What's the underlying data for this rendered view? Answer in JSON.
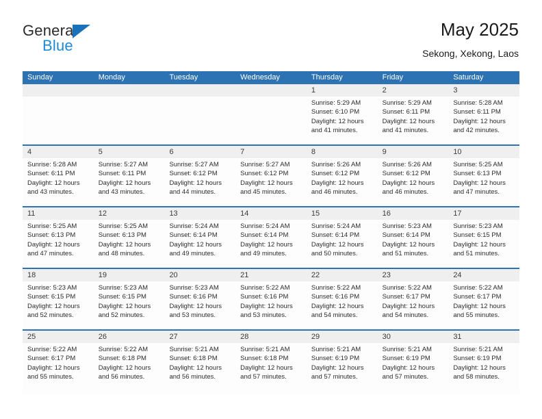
{
  "logo": {
    "primary_text": "General",
    "secondary_text": "Blue",
    "primary_color": "#2b2b2b",
    "secondary_color": "#1c8ad6",
    "triangle_color": "#1c72b8"
  },
  "header": {
    "title": "May 2025",
    "subtitle": "Sekong, Xekong, Laos"
  },
  "theme": {
    "header_blue": "#2d73b3",
    "row_divider_blue": "#2d73b3",
    "day_band_gray": "#efefef",
    "cell_background": "#fdfdfd",
    "text_color": "#2b2b2b"
  },
  "weekdays": [
    "Sunday",
    "Monday",
    "Tuesday",
    "Wednesday",
    "Thursday",
    "Friday",
    "Saturday"
  ],
  "weeks": [
    [
      {
        "day": "",
        "sunrise": "",
        "sunset": "",
        "daylight_line1": "",
        "daylight_line2": ""
      },
      {
        "day": "",
        "sunrise": "",
        "sunset": "",
        "daylight_line1": "",
        "daylight_line2": ""
      },
      {
        "day": "",
        "sunrise": "",
        "sunset": "",
        "daylight_line1": "",
        "daylight_line2": ""
      },
      {
        "day": "",
        "sunrise": "",
        "sunset": "",
        "daylight_line1": "",
        "daylight_line2": ""
      },
      {
        "day": "1",
        "sunrise": "Sunrise: 5:29 AM",
        "sunset": "Sunset: 6:10 PM",
        "daylight_line1": "Daylight: 12 hours",
        "daylight_line2": "and 41 minutes."
      },
      {
        "day": "2",
        "sunrise": "Sunrise: 5:29 AM",
        "sunset": "Sunset: 6:11 PM",
        "daylight_line1": "Daylight: 12 hours",
        "daylight_line2": "and 41 minutes."
      },
      {
        "day": "3",
        "sunrise": "Sunrise: 5:28 AM",
        "sunset": "Sunset: 6:11 PM",
        "daylight_line1": "Daylight: 12 hours",
        "daylight_line2": "and 42 minutes."
      }
    ],
    [
      {
        "day": "4",
        "sunrise": "Sunrise: 5:28 AM",
        "sunset": "Sunset: 6:11 PM",
        "daylight_line1": "Daylight: 12 hours",
        "daylight_line2": "and 43 minutes."
      },
      {
        "day": "5",
        "sunrise": "Sunrise: 5:27 AM",
        "sunset": "Sunset: 6:11 PM",
        "daylight_line1": "Daylight: 12 hours",
        "daylight_line2": "and 43 minutes."
      },
      {
        "day": "6",
        "sunrise": "Sunrise: 5:27 AM",
        "sunset": "Sunset: 6:12 PM",
        "daylight_line1": "Daylight: 12 hours",
        "daylight_line2": "and 44 minutes."
      },
      {
        "day": "7",
        "sunrise": "Sunrise: 5:27 AM",
        "sunset": "Sunset: 6:12 PM",
        "daylight_line1": "Daylight: 12 hours",
        "daylight_line2": "and 45 minutes."
      },
      {
        "day": "8",
        "sunrise": "Sunrise: 5:26 AM",
        "sunset": "Sunset: 6:12 PM",
        "daylight_line1": "Daylight: 12 hours",
        "daylight_line2": "and 46 minutes."
      },
      {
        "day": "9",
        "sunrise": "Sunrise: 5:26 AM",
        "sunset": "Sunset: 6:12 PM",
        "daylight_line1": "Daylight: 12 hours",
        "daylight_line2": "and 46 minutes."
      },
      {
        "day": "10",
        "sunrise": "Sunrise: 5:25 AM",
        "sunset": "Sunset: 6:13 PM",
        "daylight_line1": "Daylight: 12 hours",
        "daylight_line2": "and 47 minutes."
      }
    ],
    [
      {
        "day": "11",
        "sunrise": "Sunrise: 5:25 AM",
        "sunset": "Sunset: 6:13 PM",
        "daylight_line1": "Daylight: 12 hours",
        "daylight_line2": "and 47 minutes."
      },
      {
        "day": "12",
        "sunrise": "Sunrise: 5:25 AM",
        "sunset": "Sunset: 6:13 PM",
        "daylight_line1": "Daylight: 12 hours",
        "daylight_line2": "and 48 minutes."
      },
      {
        "day": "13",
        "sunrise": "Sunrise: 5:24 AM",
        "sunset": "Sunset: 6:14 PM",
        "daylight_line1": "Daylight: 12 hours",
        "daylight_line2": "and 49 minutes."
      },
      {
        "day": "14",
        "sunrise": "Sunrise: 5:24 AM",
        "sunset": "Sunset: 6:14 PM",
        "daylight_line1": "Daylight: 12 hours",
        "daylight_line2": "and 49 minutes."
      },
      {
        "day": "15",
        "sunrise": "Sunrise: 5:24 AM",
        "sunset": "Sunset: 6:14 PM",
        "daylight_line1": "Daylight: 12 hours",
        "daylight_line2": "and 50 minutes."
      },
      {
        "day": "16",
        "sunrise": "Sunrise: 5:23 AM",
        "sunset": "Sunset: 6:14 PM",
        "daylight_line1": "Daylight: 12 hours",
        "daylight_line2": "and 51 minutes."
      },
      {
        "day": "17",
        "sunrise": "Sunrise: 5:23 AM",
        "sunset": "Sunset: 6:15 PM",
        "daylight_line1": "Daylight: 12 hours",
        "daylight_line2": "and 51 minutes."
      }
    ],
    [
      {
        "day": "18",
        "sunrise": "Sunrise: 5:23 AM",
        "sunset": "Sunset: 6:15 PM",
        "daylight_line1": "Daylight: 12 hours",
        "daylight_line2": "and 52 minutes."
      },
      {
        "day": "19",
        "sunrise": "Sunrise: 5:23 AM",
        "sunset": "Sunset: 6:15 PM",
        "daylight_line1": "Daylight: 12 hours",
        "daylight_line2": "and 52 minutes."
      },
      {
        "day": "20",
        "sunrise": "Sunrise: 5:23 AM",
        "sunset": "Sunset: 6:16 PM",
        "daylight_line1": "Daylight: 12 hours",
        "daylight_line2": "and 53 minutes."
      },
      {
        "day": "21",
        "sunrise": "Sunrise: 5:22 AM",
        "sunset": "Sunset: 6:16 PM",
        "daylight_line1": "Daylight: 12 hours",
        "daylight_line2": "and 53 minutes."
      },
      {
        "day": "22",
        "sunrise": "Sunrise: 5:22 AM",
        "sunset": "Sunset: 6:16 PM",
        "daylight_line1": "Daylight: 12 hours",
        "daylight_line2": "and 54 minutes."
      },
      {
        "day": "23",
        "sunrise": "Sunrise: 5:22 AM",
        "sunset": "Sunset: 6:17 PM",
        "daylight_line1": "Daylight: 12 hours",
        "daylight_line2": "and 54 minutes."
      },
      {
        "day": "24",
        "sunrise": "Sunrise: 5:22 AM",
        "sunset": "Sunset: 6:17 PM",
        "daylight_line1": "Daylight: 12 hours",
        "daylight_line2": "and 55 minutes."
      }
    ],
    [
      {
        "day": "25",
        "sunrise": "Sunrise: 5:22 AM",
        "sunset": "Sunset: 6:17 PM",
        "daylight_line1": "Daylight: 12 hours",
        "daylight_line2": "and 55 minutes."
      },
      {
        "day": "26",
        "sunrise": "Sunrise: 5:22 AM",
        "sunset": "Sunset: 6:18 PM",
        "daylight_line1": "Daylight: 12 hours",
        "daylight_line2": "and 56 minutes."
      },
      {
        "day": "27",
        "sunrise": "Sunrise: 5:21 AM",
        "sunset": "Sunset: 6:18 PM",
        "daylight_line1": "Daylight: 12 hours",
        "daylight_line2": "and 56 minutes."
      },
      {
        "day": "28",
        "sunrise": "Sunrise: 5:21 AM",
        "sunset": "Sunset: 6:18 PM",
        "daylight_line1": "Daylight: 12 hours",
        "daylight_line2": "and 57 minutes."
      },
      {
        "day": "29",
        "sunrise": "Sunrise: 5:21 AM",
        "sunset": "Sunset: 6:19 PM",
        "daylight_line1": "Daylight: 12 hours",
        "daylight_line2": "and 57 minutes."
      },
      {
        "day": "30",
        "sunrise": "Sunrise: 5:21 AM",
        "sunset": "Sunset: 6:19 PM",
        "daylight_line1": "Daylight: 12 hours",
        "daylight_line2": "and 57 minutes."
      },
      {
        "day": "31",
        "sunrise": "Sunrise: 5:21 AM",
        "sunset": "Sunset: 6:19 PM",
        "daylight_line1": "Daylight: 12 hours",
        "daylight_line2": "and 58 minutes."
      }
    ]
  ]
}
